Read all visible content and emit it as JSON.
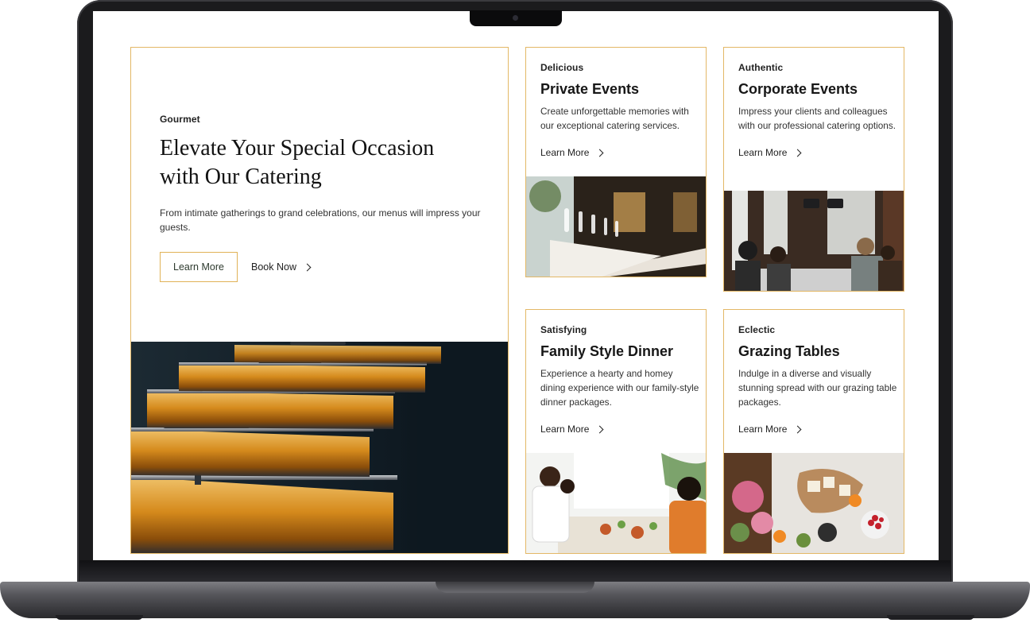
{
  "hero": {
    "eyebrow": "Gourmet",
    "title_line1": "Elevate Your Special Occasion",
    "title_line2": "with Our Catering",
    "description": "From intimate gatherings to grand celebrations, our menus will impress your guests.",
    "primary_button": "Learn More",
    "secondary_button": "Book Now",
    "image_subject": "chafing-dishes-photo"
  },
  "cards": [
    {
      "eyebrow": "Delicious",
      "title": "Private Events",
      "description": "Create unforgettable memories with our exceptional catering services.",
      "link": "Learn More",
      "image_subject": "banquet-table-photo"
    },
    {
      "eyebrow": "Authentic",
      "title": "Corporate Events",
      "description": "Impress your clients and colleagues with our professional catering options.",
      "link": "Learn More",
      "image_subject": "office-meeting-photo"
    },
    {
      "eyebrow": "Satisfying",
      "title": "Family Style Dinner",
      "description": "Experience a hearty and homey dining experience with our family-style dinner packages.",
      "link": "Learn More",
      "image_subject": "family-dinner-photo"
    },
    {
      "eyebrow": "Eclectic",
      "title": "Grazing Tables",
      "description": "Indulge in a diverse and visually stunning spread with our grazing table packages.",
      "link": "Learn More",
      "image_subject": "grazing-board-photo"
    }
  ],
  "colors": {
    "accent_border": "#e3b866",
    "button_text": "#2d3a2e",
    "laptop_body": "#1b1b1d"
  }
}
